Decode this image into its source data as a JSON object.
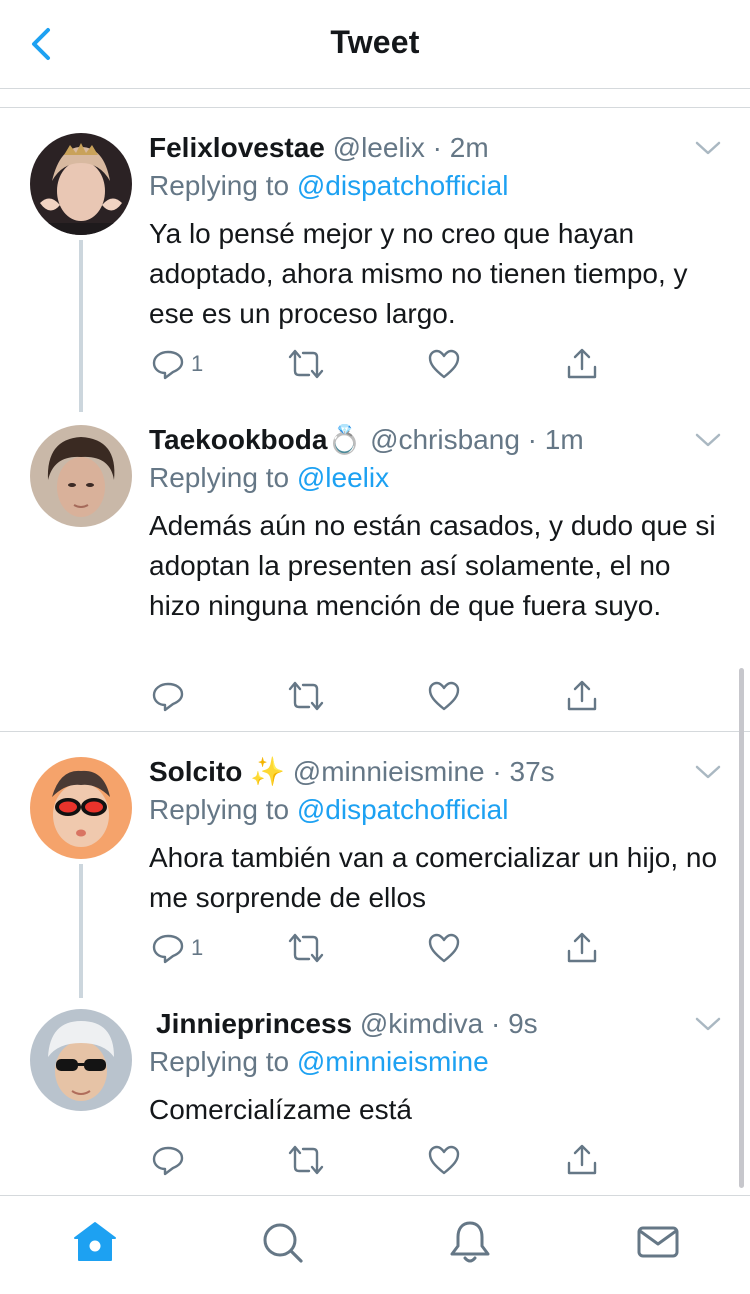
{
  "header": {
    "title": "Tweet",
    "back_icon": "chevron-left-icon",
    "accent": "#1da1f2"
  },
  "tweets": [
    {
      "name": "Felixlovestae",
      "handle": "@leelix",
      "time": "2m",
      "replying_prefix": "Replying to",
      "replying_to": "@dispatchofficial",
      "text": "Ya lo pensé mejor y no creo que hayan adoptado, ahora mismo no tienen tiempo, y ese es un proceso largo.",
      "reply_count": "1"
    },
    {
      "name": "Taekookboda",
      "name_emoji": "💍",
      "handle": "@chrisbang",
      "time": "1m",
      "replying_prefix": "Replying to",
      "replying_to": "@leelix",
      "text": "Además aún no están casados, y dudo que si adoptan la presenten así solamente, el no hizo ninguna mención de que fuera suyo.",
      "reply_count": ""
    },
    {
      "name": "Solcito",
      "name_emoji": "✨",
      "handle": "@minnieismine",
      "time": "37s",
      "replying_prefix": "Replying to",
      "replying_to": "@dispatchofficial",
      "text": "Ahora también van a comercializar un hijo, no me sorprende de ellos",
      "reply_count": "1"
    },
    {
      "name": "Jinnieprincess",
      "handle": "@kimdiva",
      "time": "9s",
      "replying_prefix": "Replying to",
      "replying_to": "@minnieismine",
      "text": "Comercialízame está",
      "reply_count": ""
    }
  ],
  "actions_icons": [
    "reply-icon",
    "retweet-icon",
    "like-icon",
    "share-icon"
  ],
  "tabbar": {
    "tabs": [
      "home-icon",
      "search-icon",
      "notifications-icon",
      "messages-icon"
    ],
    "active": "home-icon"
  }
}
